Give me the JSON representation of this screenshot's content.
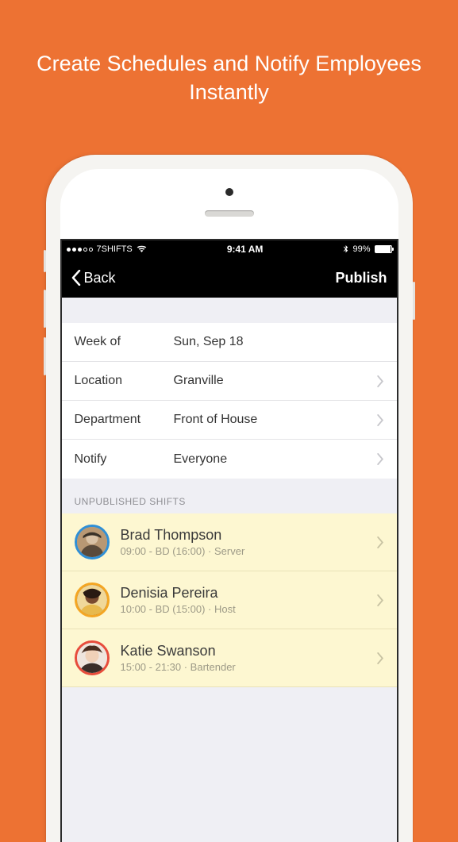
{
  "tagline": "Create Schedules and Notify Employees Instantly",
  "status": {
    "carrier": "7SHIFTS",
    "time": "9:41 AM",
    "battery_pct": "99%"
  },
  "nav": {
    "back_label": "Back",
    "publish_label": "Publish"
  },
  "settings": [
    {
      "label": "Week of",
      "value": "Sun, Sep 18",
      "chevron": false
    },
    {
      "label": "Location",
      "value": "Granville",
      "chevron": true
    },
    {
      "label": "Department",
      "value": "Front of House",
      "chevron": true
    },
    {
      "label": "Notify",
      "value": "Everyone",
      "chevron": true
    }
  ],
  "section_header": "UNPUBLISHED SHIFTS",
  "shifts": [
    {
      "name": "Brad Thompson",
      "detail": "09:00 - BD (16:00) · Server",
      "ring_color": "#2f8fd6",
      "avatar_bg": "#c9b28f"
    },
    {
      "name": "Denisia Pereira",
      "detail": "10:00 - BD (15:00) · Host",
      "ring_color": "#f4a623",
      "avatar_bg": "#6b3f2a"
    },
    {
      "name": "Katie Swanson",
      "detail": "15:00 - 21:30 · Bartender",
      "ring_color": "#e74c3c",
      "avatar_bg": "#e6c6b8"
    }
  ]
}
